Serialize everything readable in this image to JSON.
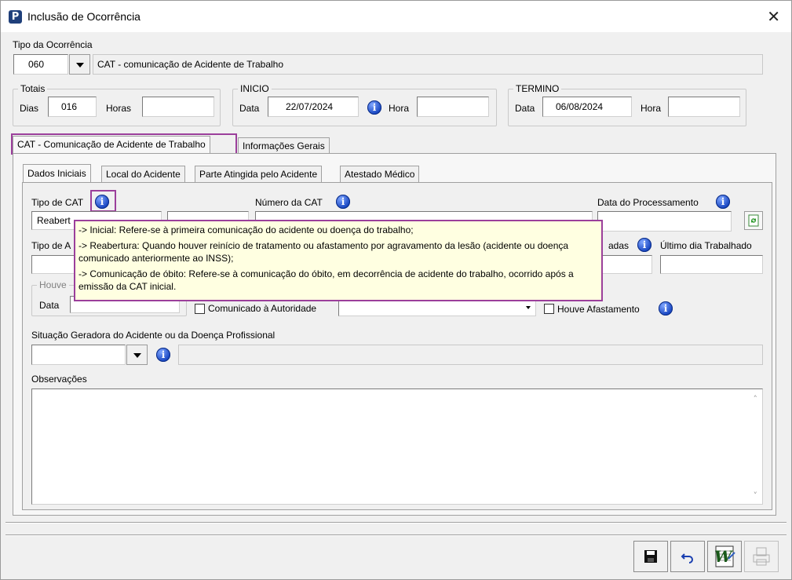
{
  "window": {
    "title": "Inclusão de Ocorrência",
    "close_glyph": "✕",
    "app_icon_letter": "P"
  },
  "tipo_ocorrencia": {
    "label": "Tipo da Ocorrência",
    "code": "060",
    "description": "CAT - comunicação de Acidente de Trabalho"
  },
  "totais": {
    "title": "Totais",
    "dias_label": "Dias",
    "dias_value": "016",
    "horas_label": "Horas",
    "horas_value": ""
  },
  "inicio": {
    "title": "INICIO",
    "data_label": "Data",
    "data_value": "22/07/2024",
    "hora_label": "Hora",
    "hora_value": ""
  },
  "termino": {
    "title": "TERMINO",
    "data_label": "Data",
    "data_value": "06/08/2024",
    "hora_label": "Hora",
    "hora_value": ""
  },
  "outer_tabs": [
    "CAT - Comunicação de Acidente de Trabalho",
    "Informações Gerais"
  ],
  "inner_tabs": [
    "Dados Iniciais",
    "Local do Acidente",
    "Parte Atingida pelo Acidente",
    "Atestado Médico"
  ],
  "dados": {
    "tipo_cat_label": "Tipo de CAT",
    "tipo_cat_value": "Reabert",
    "numero_cat_label": "Número da CAT",
    "data_processamento_label": "Data do Processamento",
    "tipo_partial_label": "Tipo de A",
    "horas_partial_label": "adas",
    "ultimo_dia_label": "Último dia Trabalhado",
    "houve_partial_label": "Houve",
    "data_label": "Data",
    "comunicado_label": "Comunicado à Autoridade",
    "houve_afastamento_label": "Houve Afastamento",
    "situacao_label": "Situação Geradora do Acidente ou da Doença Profissional",
    "observacoes_label": "Observações"
  },
  "tooltip": {
    "line1": "-> Inicial: Refere-se à primeira comunicação do acidente ou doença do trabalho;",
    "line2": "-> Reabertura: Quando houver reinício de tratamento ou afastamento por agravamento da lesão (acidente ou doença comunicado anteriormente ao INSS);",
    "line3": "-> Comunicação de óbito: Refere-se à comunicação do óbito, em decorrência de acidente do trabalho, ocorrido após a emissão da CAT inicial."
  },
  "icons": {
    "info": "i",
    "scroll_up": "˄",
    "scroll_down": "˅"
  },
  "colors": {
    "highlight": "#9b3f9b",
    "tooltip_bg": "#ffffe1",
    "info_blue": "#1745c0"
  }
}
